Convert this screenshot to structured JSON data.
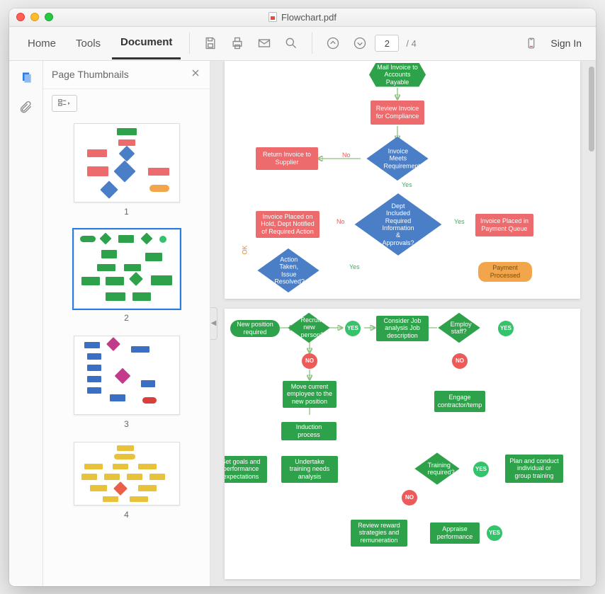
{
  "window": {
    "title": "Flowchart.pdf"
  },
  "toolbar": {
    "tabs": {
      "home": "Home",
      "tools": "Tools",
      "document": "Document"
    },
    "page_current": "2",
    "page_total": "/ 4",
    "signin": "Sign In"
  },
  "thumbnails": {
    "title": "Page Thumbnails",
    "pages": [
      "1",
      "2",
      "3",
      "4"
    ],
    "selected": "2"
  },
  "doc1": {
    "s1": "Mail Invoice to Accounts Payable",
    "s2": "Review Invoice for Compliance",
    "s3": "Invoice Meets Requirement?",
    "s4": "Return Invoice to Supplier",
    "s5": "Dept Included Required Information & Approvals?",
    "s6": "Invoice Placed on Hold, Dept Notified of Required Action",
    "s7": "Invoice Placed in Payment Queue",
    "s8": "Action Taken, Issue Resolved?",
    "s9": "Payment Processed",
    "yes": "Yes",
    "no": "No",
    "ok": "OK"
  },
  "doc2": {
    "n1": "New position required",
    "n2": "Recruit new person?",
    "n3": "Consider Job analysis Job description",
    "n4": "Employ staff?",
    "n5": "Move current employee to the new position",
    "n6": "Engage contractor/temp",
    "n7": "Induction process",
    "n8": "Set goals and performance expectations",
    "n9": "Undertake training needs analysis",
    "n10": "Training required?",
    "n11": "Plan and conduct individual or group training",
    "n12": "Appraise performance",
    "n13": "Review reward strategies and remuneration",
    "yes": "YES",
    "no": "NO"
  }
}
